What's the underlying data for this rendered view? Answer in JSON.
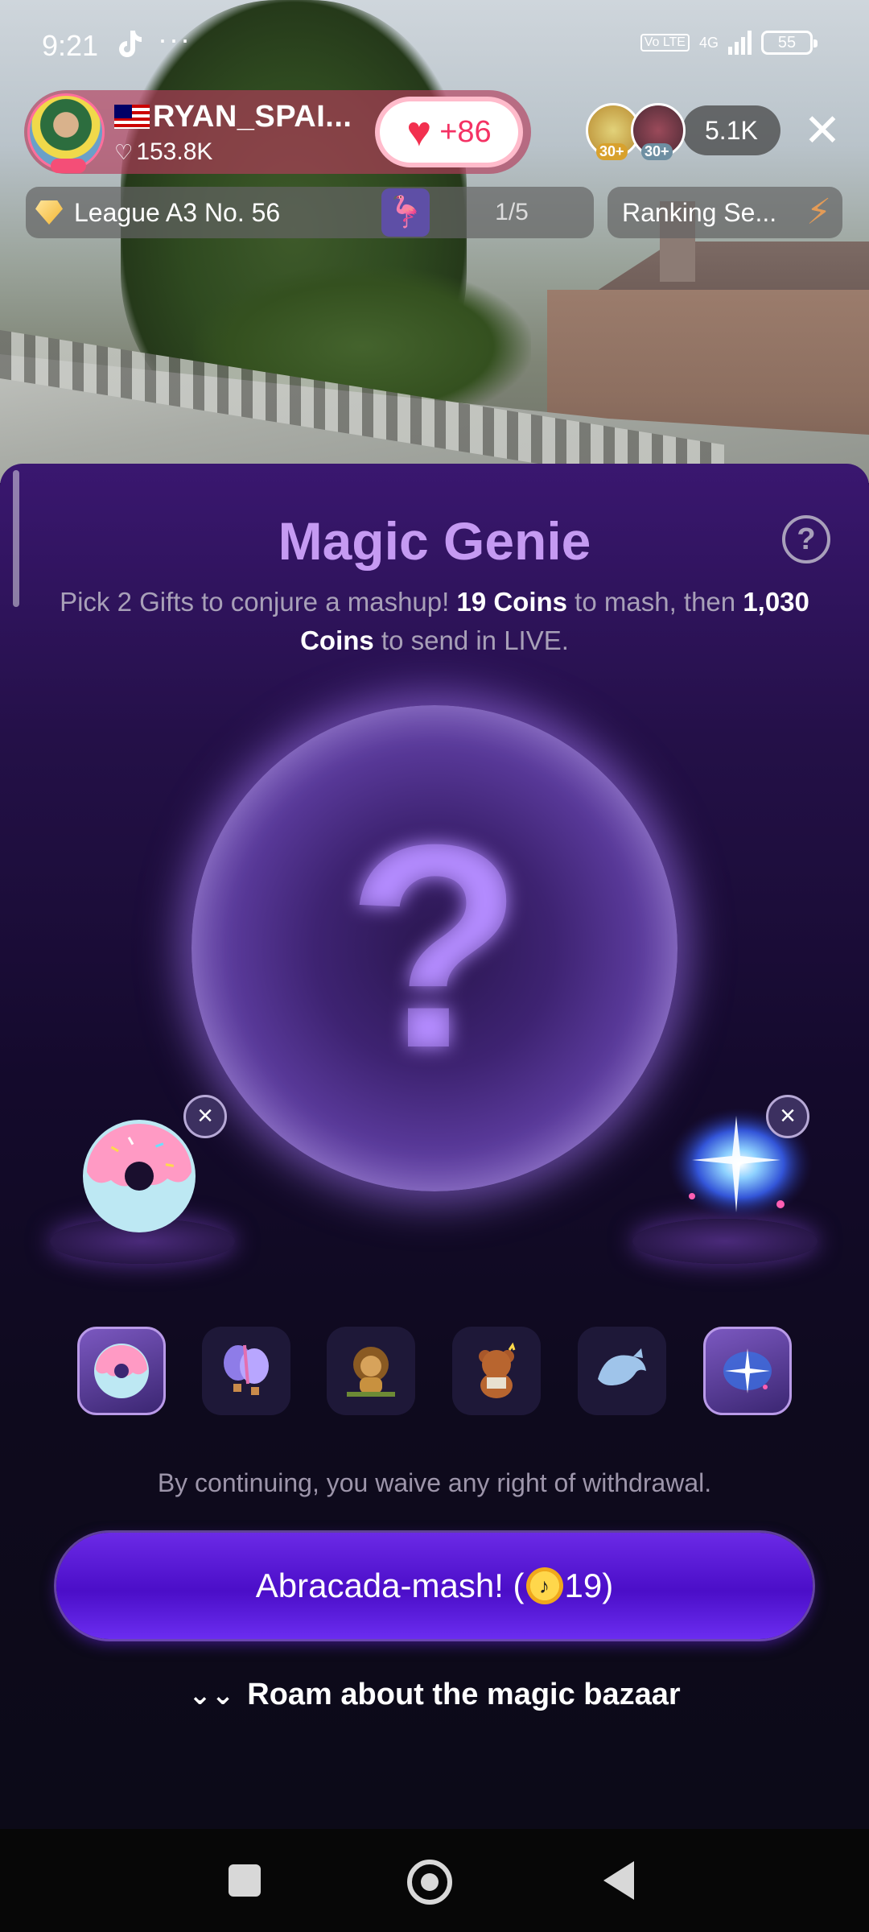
{
  "status_bar": {
    "time": "9:21",
    "more": "···",
    "volte": "Vo LTE",
    "network": "4G",
    "battery": "55"
  },
  "host": {
    "name": "RYAN_SPAI...",
    "likes": "153.8K",
    "follow_count": "+86"
  },
  "viewers": {
    "badges": [
      "30+",
      "30+"
    ],
    "count": "5.1K"
  },
  "league": {
    "label": "League A3 No. 56",
    "progress": "1/5"
  },
  "ranking": {
    "label": "Ranking Se..."
  },
  "sheet": {
    "title": "Magic Genie",
    "help": "?",
    "desc_prefix": "Pick 2 Gifts to conjure a mashup! ",
    "mash_coins": "19 Coins",
    "desc_mid": " to mash, then ",
    "send_coins": "1,030 Coins",
    "desc_suffix": " to send in LIVE.",
    "orb_glyph": "?",
    "remove_glyph": "×",
    "waiver": "By continuing, you waive any right of withdrawal.",
    "mash_button_prefix": "Abracada-mash! (",
    "mash_button_cost": "19",
    "mash_button_suffix": ")",
    "bazaar": "Roam about the magic bazaar"
  },
  "gifts": [
    {
      "name": "donut",
      "selected": true
    },
    {
      "name": "hot-air-balloons",
      "selected": false
    },
    {
      "name": "lion",
      "selected": false
    },
    {
      "name": "teddy-bear",
      "selected": false
    },
    {
      "name": "whale",
      "selected": false
    },
    {
      "name": "galaxy",
      "selected": true
    }
  ],
  "colors": {
    "accent": "#c59af2",
    "button": "#5a17dd",
    "follow_heart": "#f2304f"
  }
}
